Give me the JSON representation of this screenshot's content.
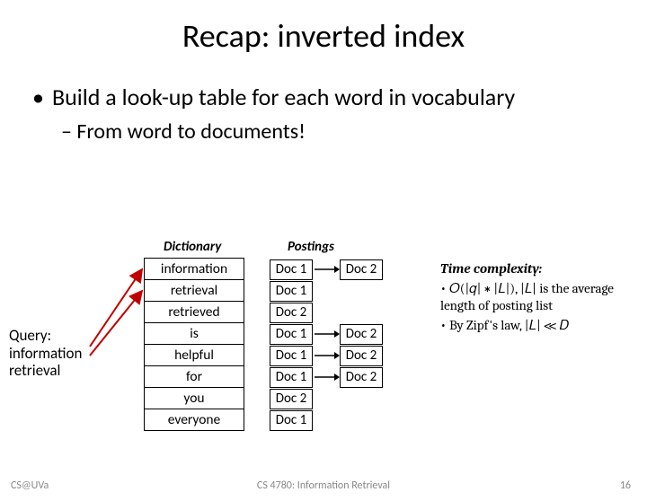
{
  "title": "Recap: inverted index",
  "bullet1": "Build a look-up table for each word in vocabulary",
  "bullet2": "From word to documents!",
  "headers": {
    "dict": "Dictionary",
    "postings": "Postings"
  },
  "query": {
    "line1": "Query:",
    "line2": "information",
    "line3": "retrieval"
  },
  "dictionary": [
    "information",
    "retrieval",
    "retrieved",
    "is",
    "helpful",
    "for",
    "you",
    "everyone"
  ],
  "postings": [
    [
      "Doc 1",
      "Doc 2"
    ],
    [
      "Doc 1"
    ],
    [
      "Doc 2"
    ],
    [
      "Doc 1",
      "Doc 2"
    ],
    [
      "Doc 1",
      "Doc 2"
    ],
    [
      "Doc 1",
      "Doc 2"
    ],
    [
      "Doc 2"
    ],
    [
      "Doc 1"
    ]
  ],
  "notes": {
    "heading": "Time complexity:",
    "formula": "𝑂(|𝑞| ∗ |𝐿|), |𝐿| is the average length of posting list",
    "zipf": "By Zipf's law, |𝐿| ≪ 𝐷"
  },
  "footer": {
    "left": "CS@UVa",
    "center": "CS 4780: Information Retrieval",
    "right": "16"
  }
}
